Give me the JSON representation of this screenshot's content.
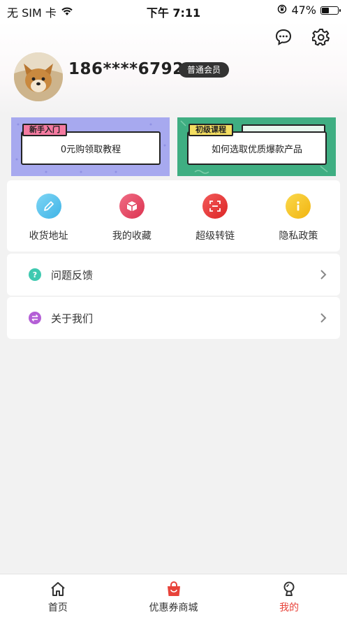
{
  "status_bar": {
    "carrier": "无 SIM 卡",
    "time": "下午 7:11",
    "battery": "47%",
    "battery_level": 0.47
  },
  "profile": {
    "username": "186****6792",
    "member_level": "普通会员"
  },
  "banners": [
    {
      "tag": "新手入门",
      "text": "0元购领取教程"
    },
    {
      "tag": "初级课程",
      "text": "如何选取优质爆款产品"
    }
  ],
  "quick_actions": [
    {
      "label": "收货地址",
      "icon": "pencil-icon",
      "color": "#54c0ea"
    },
    {
      "label": "我的收藏",
      "icon": "box-icon",
      "color": "#e8465e"
    },
    {
      "label": "超级转链",
      "icon": "scan-icon",
      "color": "#e8363a"
    },
    {
      "label": "隐私政策",
      "icon": "info-icon",
      "color": "#f6c21c"
    }
  ],
  "menu": [
    {
      "label": "问题反馈",
      "icon": "question-icon",
      "color": "#3fc9b0"
    },
    {
      "label": "关于我们",
      "icon": "swap-icon",
      "color": "#b45fd6"
    }
  ],
  "tabbar": [
    {
      "label": "首页",
      "icon": "home-icon"
    },
    {
      "label": "优惠券商城",
      "icon": "shopping-bag-icon"
    },
    {
      "label": "我的",
      "icon": "profile-icon",
      "active": true
    }
  ],
  "colors": {
    "accent": "#e8433a",
    "badge_bg": "#333333"
  }
}
